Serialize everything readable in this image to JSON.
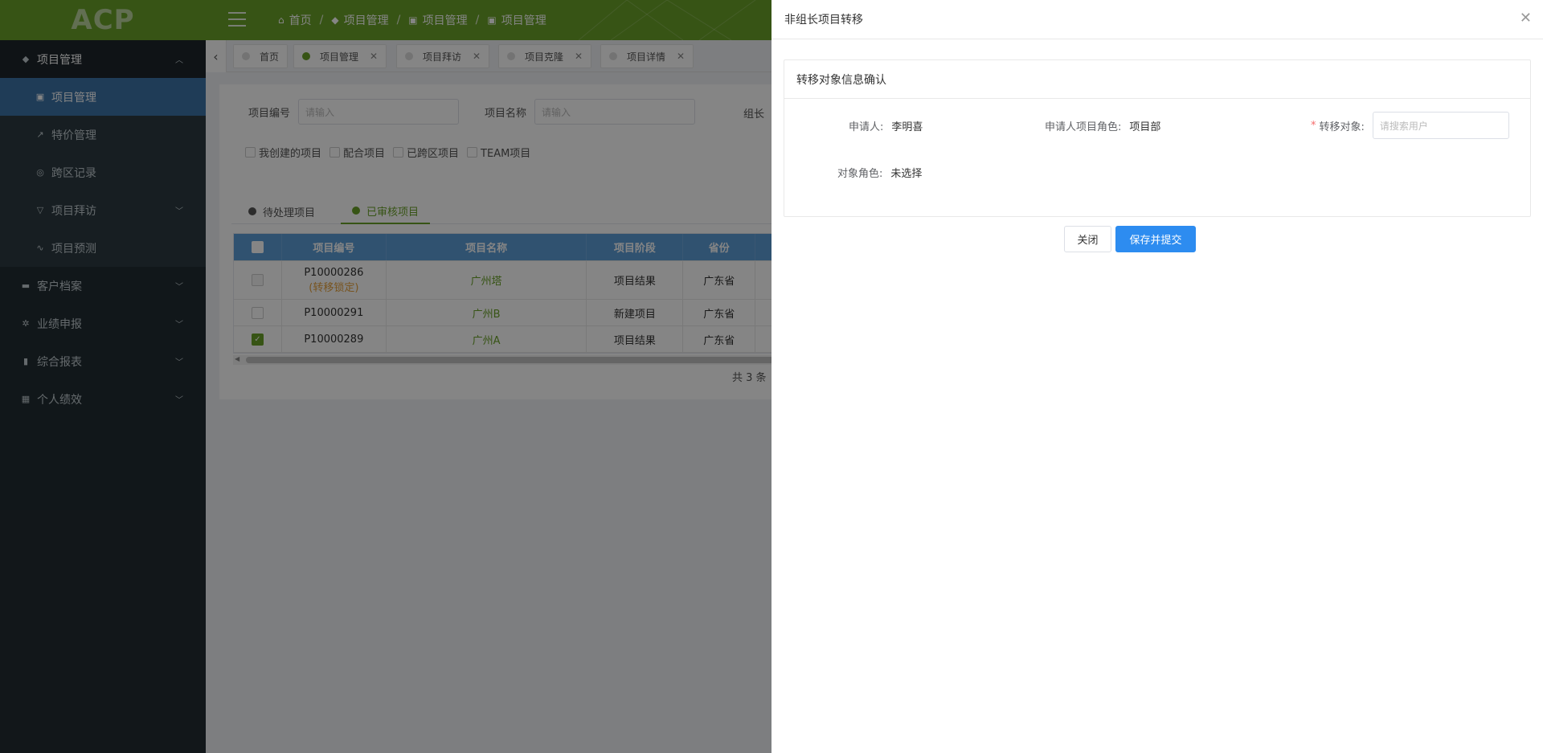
{
  "header": {
    "logo": "ACP",
    "breadcrumb": [
      "首页",
      "项目管理",
      "项目管理",
      "项目管理"
    ]
  },
  "sidebar": {
    "items": [
      {
        "label": "项目管理",
        "icon": "tag-icon",
        "level": "top",
        "expanded": true
      },
      {
        "label": "项目管理",
        "icon": "doc-icon",
        "level": "sub",
        "active": true
      },
      {
        "label": "特价管理",
        "icon": "trend-icon",
        "level": "sub"
      },
      {
        "label": "跨区记录",
        "icon": "target-icon",
        "level": "sub"
      },
      {
        "label": "项目拜访",
        "icon": "filter-icon",
        "level": "sub",
        "expandable": true
      },
      {
        "label": "项目预测",
        "icon": "pulse-icon",
        "level": "sub"
      },
      {
        "label": "客户档案",
        "icon": "folder-icon",
        "level": "group",
        "expandable": true
      },
      {
        "label": "业绩申报",
        "icon": "gear-icon",
        "level": "group",
        "expandable": true
      },
      {
        "label": "综合报表",
        "icon": "book-icon",
        "level": "group",
        "expandable": true
      },
      {
        "label": "个人绩效",
        "icon": "grid-icon",
        "level": "group",
        "expandable": true
      }
    ]
  },
  "tabs": [
    {
      "label": "首页",
      "active": false,
      "closable": false
    },
    {
      "label": "项目管理",
      "active": true,
      "closable": true
    },
    {
      "label": "项目拜访",
      "active": false,
      "closable": true
    },
    {
      "label": "项目克隆",
      "active": false,
      "closable": true
    },
    {
      "label": "项目详情",
      "active": false,
      "closable": true
    }
  ],
  "filters": {
    "project_no_label": "项目编号",
    "project_no_placeholder": "请输入",
    "project_name_label": "项目名称",
    "project_name_placeholder": "请输入",
    "leader_label": "组长",
    "checkboxes": [
      "我创建的项目",
      "配合项目",
      "已跨区项目",
      "TEAM项目"
    ]
  },
  "subtabs": [
    "待处理项目",
    "已审核项目"
  ],
  "table": {
    "columns": [
      "项目编号",
      "项目名称",
      "项目阶段",
      "省份"
    ],
    "rows": [
      {
        "no": "P10000286",
        "note": "(转移锁定)",
        "name": "广州塔",
        "stage": "项目结果",
        "province": "广东省",
        "checked": false,
        "disabled": true
      },
      {
        "no": "P10000291",
        "note": "",
        "name": "广州B",
        "stage": "新建项目",
        "province": "广东省",
        "checked": false,
        "disabled": false
      },
      {
        "no": "P10000289",
        "note": "",
        "name": "广州A",
        "stage": "项目结果",
        "province": "广东省",
        "checked": true,
        "disabled": false
      }
    ],
    "total": "共 3 条"
  },
  "drawer": {
    "title": "非组长项目转移",
    "panel_title": "转移对象信息确认",
    "applicant_label": "申请人:",
    "applicant_value": "李明喜",
    "applicant_role_label": "申请人项目角色:",
    "applicant_role_value": "项目部",
    "target_label": "转移对象:",
    "target_placeholder": "请搜索用户",
    "target_role_label": "对象角色:",
    "target_role_value": "未选择",
    "close_label": "关闭",
    "submit_label": "保存并提交"
  },
  "colors": {
    "brand": "#6aa229",
    "sidebar": "#222d32",
    "active_menu": "#3c73a8",
    "table_head": "#5d9dd6",
    "primary_button": "#2d8cf0"
  }
}
